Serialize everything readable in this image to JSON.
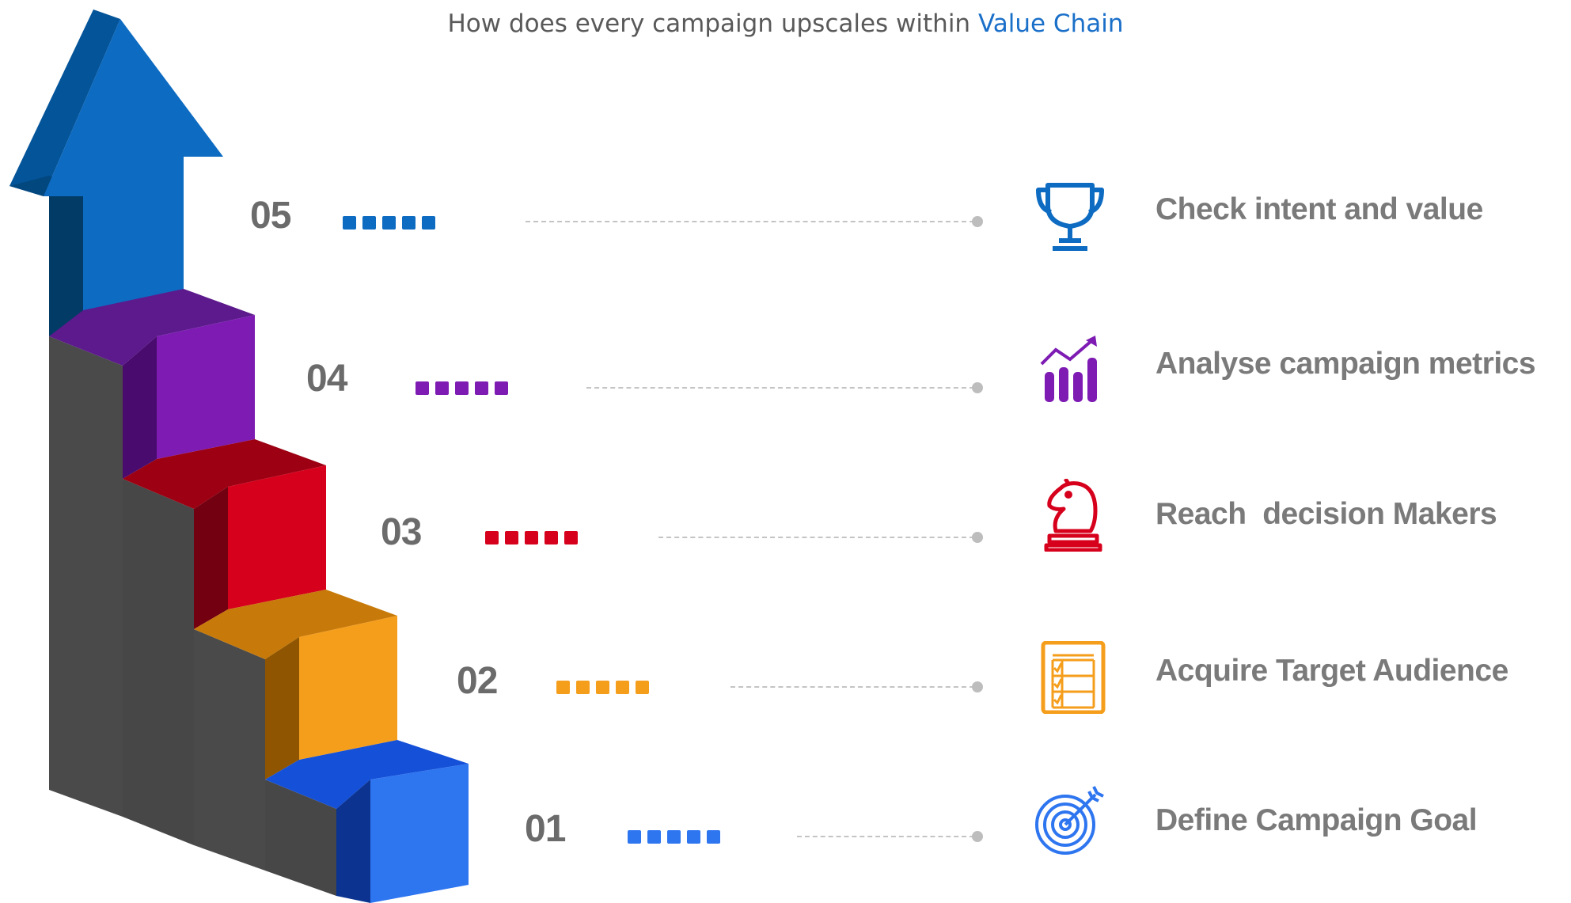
{
  "title": {
    "prefix": "How does every campaign upscales within ",
    "highlight": "Value Chain"
  },
  "colors": {
    "title_text": "#595959",
    "title_accent": "#1a6fc9",
    "number_text": "#6b6b6b",
    "label_text": "#7a7a7a",
    "step_grey": "#4a4a4a"
  },
  "steps": [
    {
      "number": "01",
      "label": "Define Campaign Goal",
      "icon": "target-dart-icon",
      "color": "#2e75f0"
    },
    {
      "number": "02",
      "label": "Acquire Target Audience",
      "icon": "checklist-icon",
      "color": "#f59e1c"
    },
    {
      "number": "03",
      "label": "Reach  decision Makers",
      "icon": "chess-knight-icon",
      "color": "#d6001c"
    },
    {
      "number": "04",
      "label": "Analyse campaign metrics",
      "icon": "growth-chart-icon",
      "color": "#7d1bb3"
    },
    {
      "number": "05",
      "label": "Check intent and value",
      "icon": "trophy-icon",
      "color": "#0d6bc2"
    }
  ]
}
